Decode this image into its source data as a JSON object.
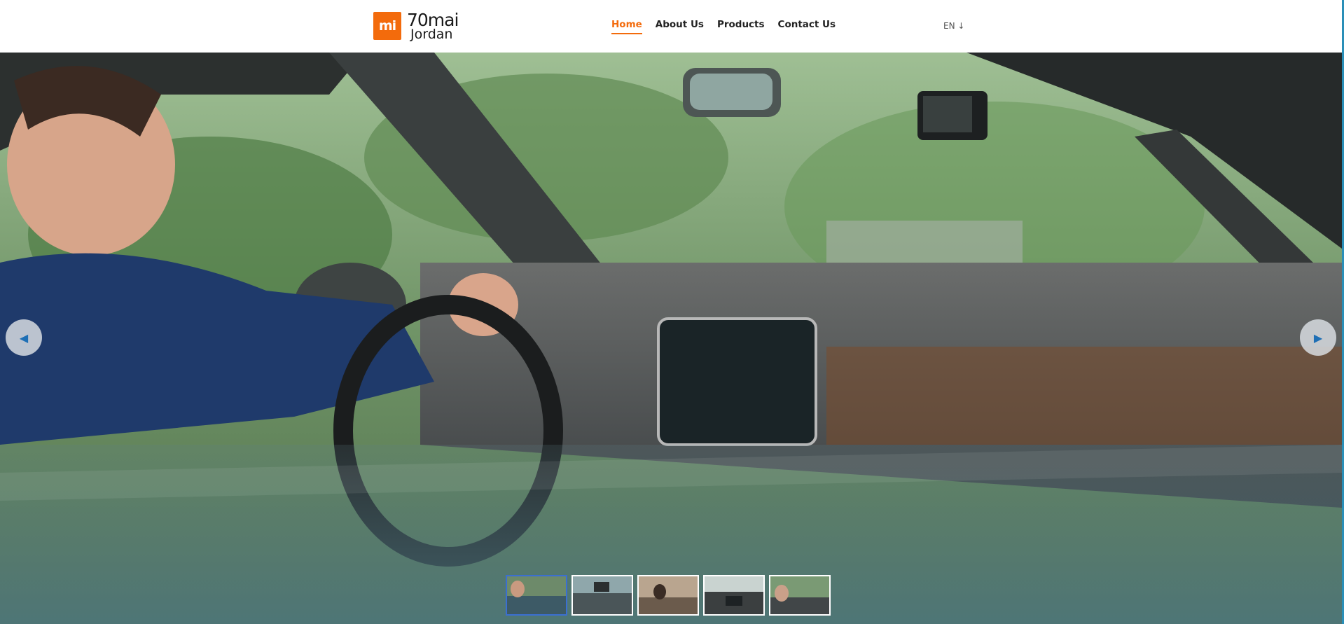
{
  "header": {
    "logo": {
      "badge": "mi",
      "brand": "70mai",
      "sub": "Jordan"
    },
    "nav": [
      {
        "label": "Home",
        "active": true
      },
      {
        "label": "About Us",
        "active": false
      },
      {
        "label": "Products",
        "active": false
      },
      {
        "label": "Contact Us",
        "active": false
      }
    ],
    "language": "EN ↓"
  },
  "hero": {
    "prev_icon": "◀",
    "next_icon": "▶",
    "thumbnails": [
      {
        "active": true
      },
      {
        "active": false
      },
      {
        "active": false
      },
      {
        "active": false
      },
      {
        "active": false
      }
    ]
  },
  "colors": {
    "accent": "#f36b0c",
    "active_thumb": "#3b6fd1",
    "arrow_icon": "#1e6fb5"
  }
}
